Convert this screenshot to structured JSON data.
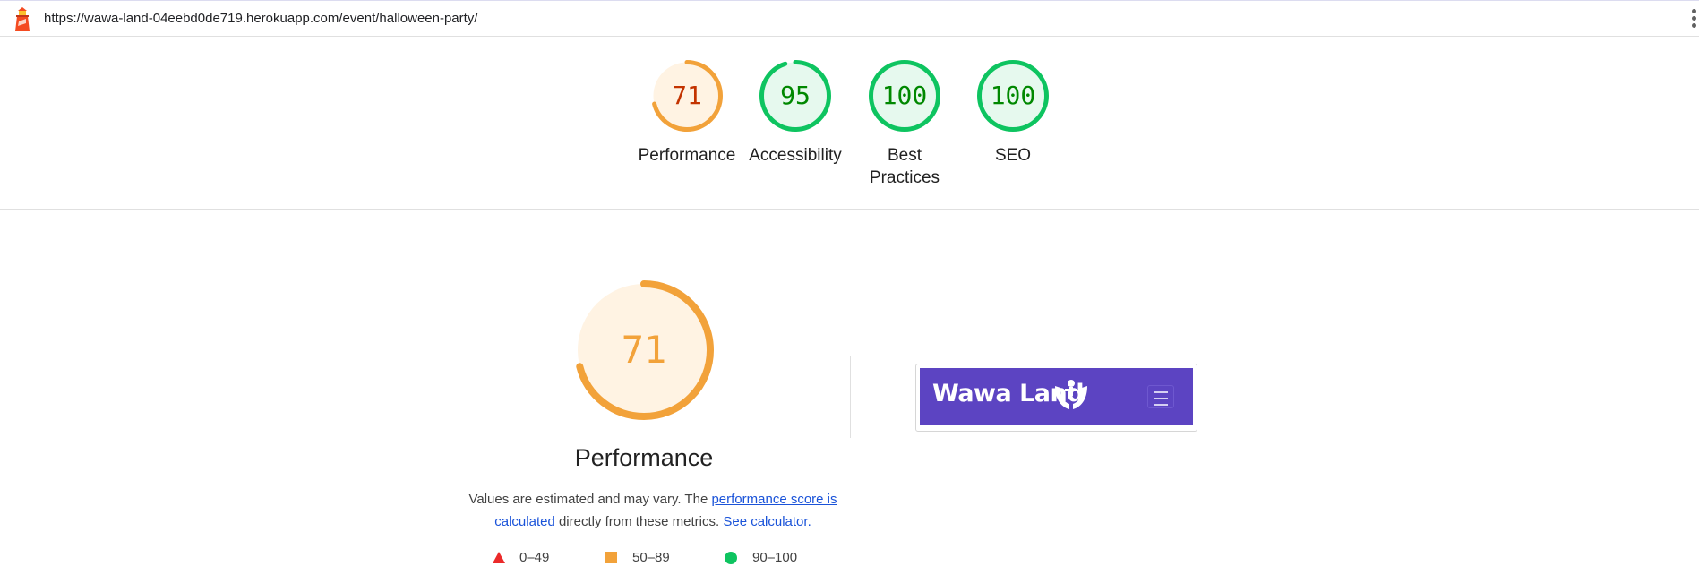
{
  "topbar": {
    "url": "https://wawa-land-04eebd0de719.herokuapp.com/event/halloween-party/",
    "logo_icon": "lighthouse-icon",
    "menu_icon": "kebab-menu-icon"
  },
  "summary": [
    {
      "score": "71",
      "label": "Performance",
      "fraction": 0.71,
      "color": "#f2a23a",
      "text_color": "#c33300",
      "fill": "#fff3e3"
    },
    {
      "score": "95",
      "label": "Accessibility",
      "fraction": 0.95,
      "color": "#0ec460",
      "text_color": "#008800",
      "fill": "#e6f9ee"
    },
    {
      "score": "100",
      "label": "Best Practices",
      "fraction": 1.0,
      "color": "#0ec460",
      "text_color": "#008800",
      "fill": "#e6f9ee"
    },
    {
      "score": "100",
      "label": "SEO",
      "fraction": 1.0,
      "color": "#0ec460",
      "text_color": "#008800",
      "fill": "#e6f9ee"
    }
  ],
  "main": {
    "score": "71",
    "fraction": 0.71,
    "title": "Performance",
    "desc_prefix": "Values are estimated and may vary. The ",
    "desc_link1": "performance score is calculated",
    "desc_middle": " directly from these metrics. ",
    "desc_link2": "See calculator."
  },
  "legend": {
    "fail": "0–49",
    "average": "50–89",
    "pass": "90–100"
  },
  "thumbnail": {
    "brand": "Wawa Land",
    "brand_icon": "hands-icon",
    "menu_icon": "hamburger-icon",
    "bg_color": "#5c44c2"
  }
}
